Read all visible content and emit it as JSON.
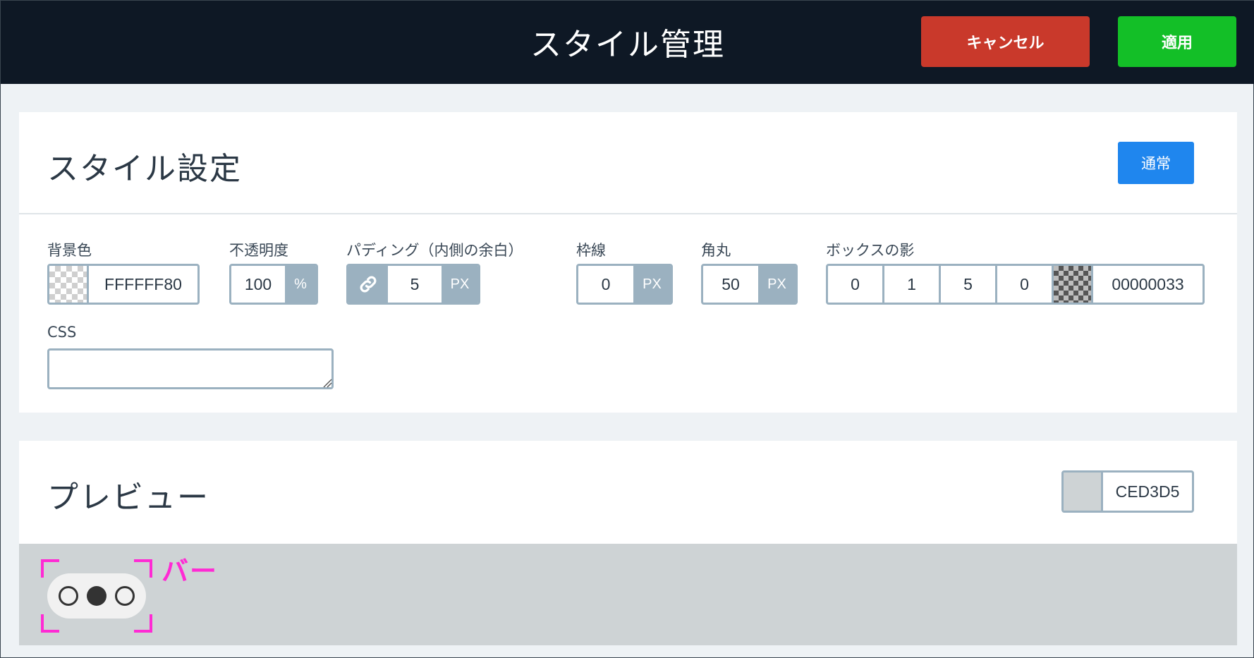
{
  "header": {
    "title": "スタイル管理",
    "cancel_label": "キャンセル",
    "apply_label": "適用"
  },
  "style_panel": {
    "title": "スタイル設定",
    "mode_button": "通常",
    "background": {
      "label": "背景色",
      "value": "FFFFFF80"
    },
    "opacity": {
      "label": "不透明度",
      "value": "100",
      "unit": "%"
    },
    "padding": {
      "label": "パディング（内側の余白）",
      "value": "5",
      "unit": "PX"
    },
    "border": {
      "label": "枠線",
      "value": "0",
      "unit": "PX"
    },
    "radius": {
      "label": "角丸",
      "value": "50",
      "unit": "PX"
    },
    "shadow": {
      "label": "ボックスの影",
      "values": [
        "0",
        "1",
        "5",
        "0"
      ],
      "color": "00000033"
    },
    "css": {
      "label": "CSS",
      "value": ""
    }
  },
  "preview_panel": {
    "title": "プレビュー",
    "bg_color": "CED3D5",
    "annotation": "バー"
  },
  "colors": {
    "header_bg": "#0e1825",
    "cancel": "#c9392b",
    "apply": "#13bf27",
    "normal": "#1f86ee",
    "annotation": "#ff2ad4"
  }
}
